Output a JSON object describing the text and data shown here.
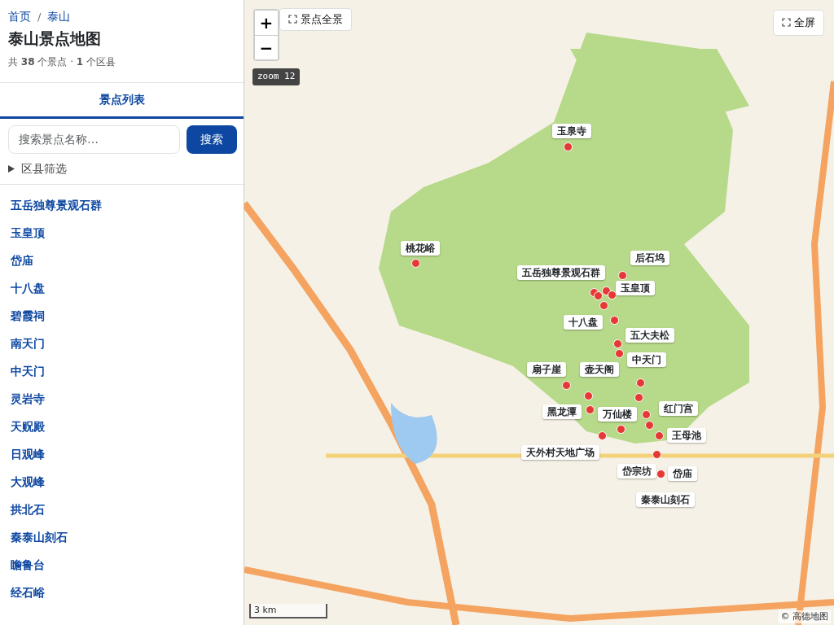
{
  "breadcrumb": [
    "首页",
    "泰山"
  ],
  "breadcrumb_separator": "/",
  "title": "泰山景点地图",
  "summary": "共 **38** 个景点 · **1** 个区县",
  "tabs": [
    {
      "label": "景点列表",
      "selected": true
    }
  ],
  "search": {
    "placeholder": "搜索景点名称…",
    "button": "搜索"
  },
  "filter": {
    "label": "区县筛选",
    "expanded": false
  },
  "spots": [
    "五岳独尊景观石群",
    "玉皇顶",
    "岱庙",
    "十八盘",
    "碧霞祠",
    "南天门",
    "中天门",
    "灵岩寺",
    "天贶殿",
    "日观峰",
    "大观峰",
    "拱北石",
    "秦泰山刻石",
    "瞻鲁台",
    "经石峪"
  ],
  "map": {
    "zoom_in": "+",
    "zoom_out": "−",
    "overview_button": "景点全景",
    "fullscreen_button": "全屏",
    "zoom_badge": "zoom 12",
    "scale": "3 km",
    "attribution": "© 高德地图",
    "markers": [
      "玉泉寺",
      "桃花峪",
      "五岳独尊景观石群",
      "后石坞",
      "玉皇顶",
      "十八盘",
      "五大夫松",
      "中天门",
      "扇子崖",
      "壶天阁",
      "黑龙潭",
      "万仙楼",
      "红门宫",
      "王母池",
      "天外村天地广场",
      "岱宗坊",
      "岱庙",
      "秦泰山刻石"
    ]
  }
}
